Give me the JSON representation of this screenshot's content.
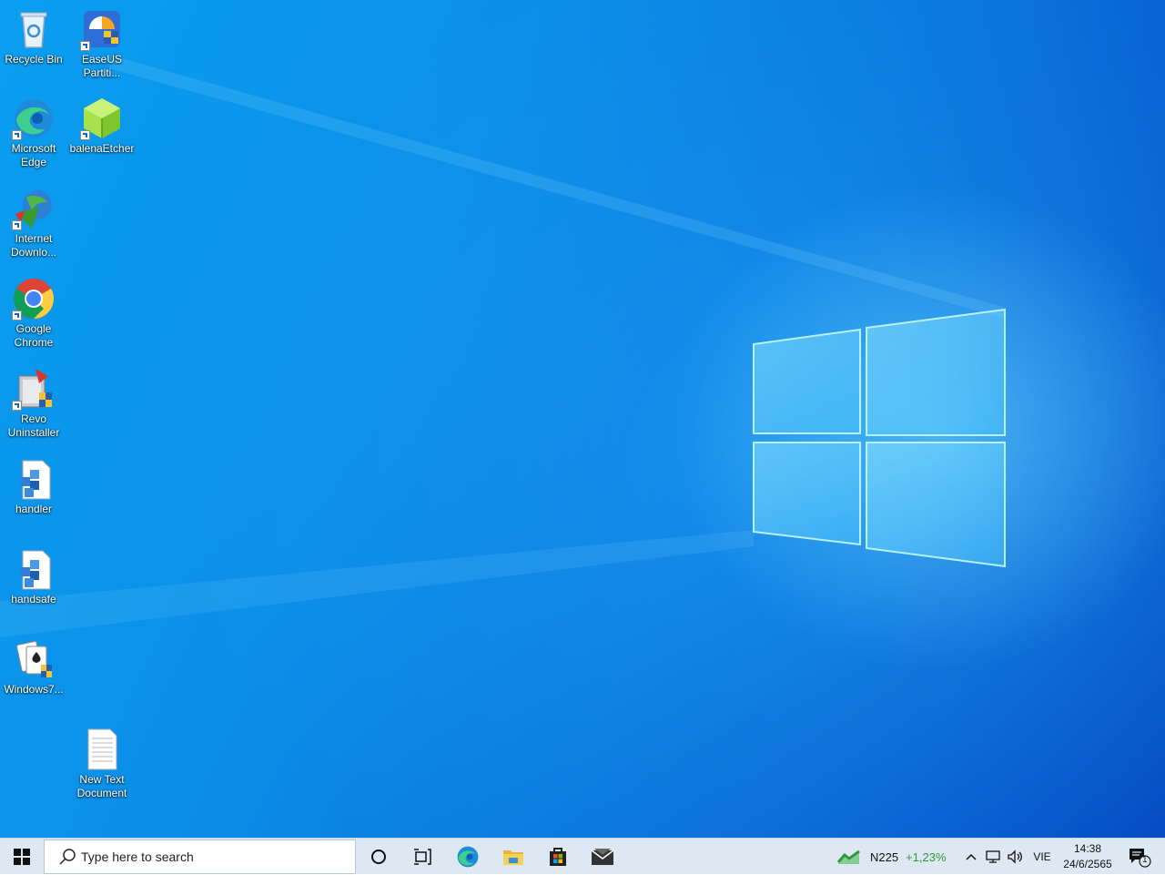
{
  "desktop": {
    "icons": [
      {
        "label": "Recycle Bin",
        "icon": "recycle-bin-icon"
      },
      {
        "label": "EaseUS Partiti...",
        "icon": "easeus-icon"
      },
      {
        "label": "Microsoft Edge",
        "icon": "edge-icon"
      },
      {
        "label": "balenaEtcher",
        "icon": "balena-etcher-icon"
      },
      {
        "label": "Internet Downlo...",
        "icon": "internet-download-manager-icon"
      },
      {
        "label": "Google Chrome",
        "icon": "chrome-icon"
      },
      {
        "label": "Revo Uninstaller",
        "icon": "revo-uninstaller-icon"
      },
      {
        "label": "handler",
        "icon": "registry-file-icon"
      },
      {
        "label": "handsafe",
        "icon": "registry-file-icon"
      },
      {
        "label": "Windows7...",
        "icon": "solitaire-icon"
      },
      {
        "label": "New Text Document",
        "icon": "text-document-icon"
      }
    ]
  },
  "taskbar": {
    "search_placeholder": "Type here to search",
    "pinned": [
      "cortana-icon",
      "task-view-icon",
      "edge-icon",
      "file-explorer-icon",
      "store-icon",
      "mail-icon"
    ],
    "stock": {
      "name": "N225",
      "change": "+1,23%",
      "change_color": "#2e9a3a"
    },
    "language": "VIE",
    "time": "14:38",
    "date": "24/6/2565",
    "notification_count": "1"
  },
  "colors": {
    "wallpaper_blue": "#0a8ee8",
    "taskbar_bg": "#dde8f3"
  }
}
